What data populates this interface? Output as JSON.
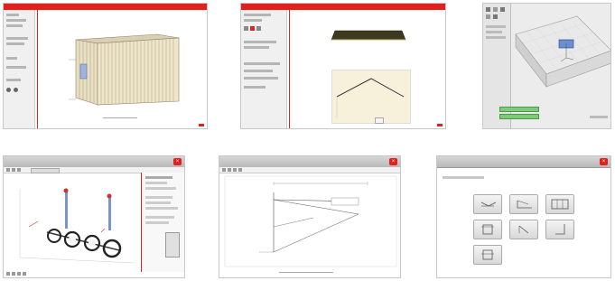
{
  "thumbnails": [
    {
      "title": "",
      "file_label": "",
      "footer_text": ""
    },
    {
      "title": "",
      "roof_label": "",
      "side_label": "",
      "button_label": ""
    },
    {
      "status1": "",
      "status2": "",
      "label1": "",
      "label2": ""
    },
    {
      "title": ""
    },
    {
      "title": "",
      "footer_text": ""
    },
    {
      "title": "",
      "tiles": [
        {
          "label": ""
        },
        {
          "label": ""
        },
        {
          "label": ""
        },
        {
          "label": ""
        },
        {
          "label": ""
        },
        {
          "label": ""
        },
        {
          "label": ""
        }
      ]
    }
  ],
  "colors": {
    "brand_red": "#e3201b",
    "wall_beige": "#efe6cc",
    "roof_dark": "#3d3a1f",
    "status_green": "#7fc97a",
    "pipe_blue": "#2a4fa0"
  },
  "icons": [
    "close-icon",
    "wall-icon",
    "roof-icon",
    "structure-3d-icon",
    "line-diagram-icon",
    "panel-icon"
  ]
}
